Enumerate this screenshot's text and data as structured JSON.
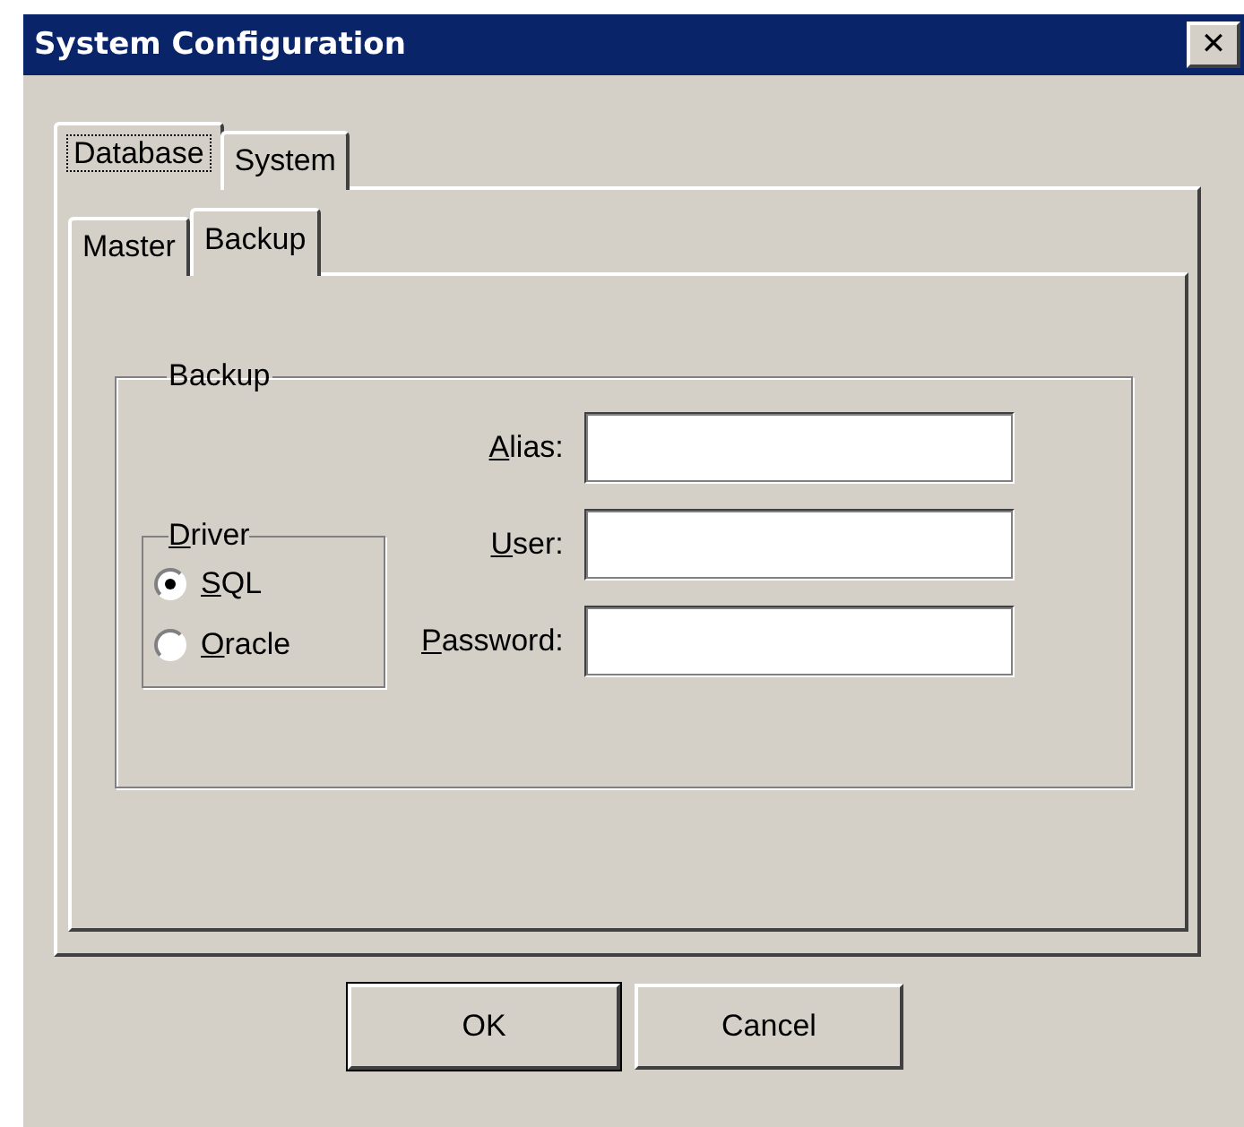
{
  "window": {
    "title": "System Configuration",
    "close": "✕"
  },
  "tabs": [
    {
      "label": "Database",
      "selected": true
    },
    {
      "label": "System",
      "selected": false
    }
  ],
  "subtabs": [
    {
      "label": "Master",
      "selected": false
    },
    {
      "label": "Backup",
      "selected": true
    }
  ],
  "group": {
    "title": "Backup"
  },
  "driver": {
    "title": {
      "hotkey": "D",
      "rest": "river"
    },
    "options": [
      {
        "hotkey": "S",
        "rest": "QL",
        "selected": true
      },
      {
        "hotkey": "O",
        "rest": "racle",
        "selected": false
      }
    ]
  },
  "fields": [
    {
      "hotkey": "A",
      "rest": "lias:"
    },
    {
      "hotkey": "U",
      "rest": "ser:"
    },
    {
      "hotkey": "P",
      "rest": "assword:"
    }
  ],
  "buttons": [
    {
      "label": "OK",
      "default": true
    },
    {
      "label": "Cancel",
      "default": false
    }
  ]
}
